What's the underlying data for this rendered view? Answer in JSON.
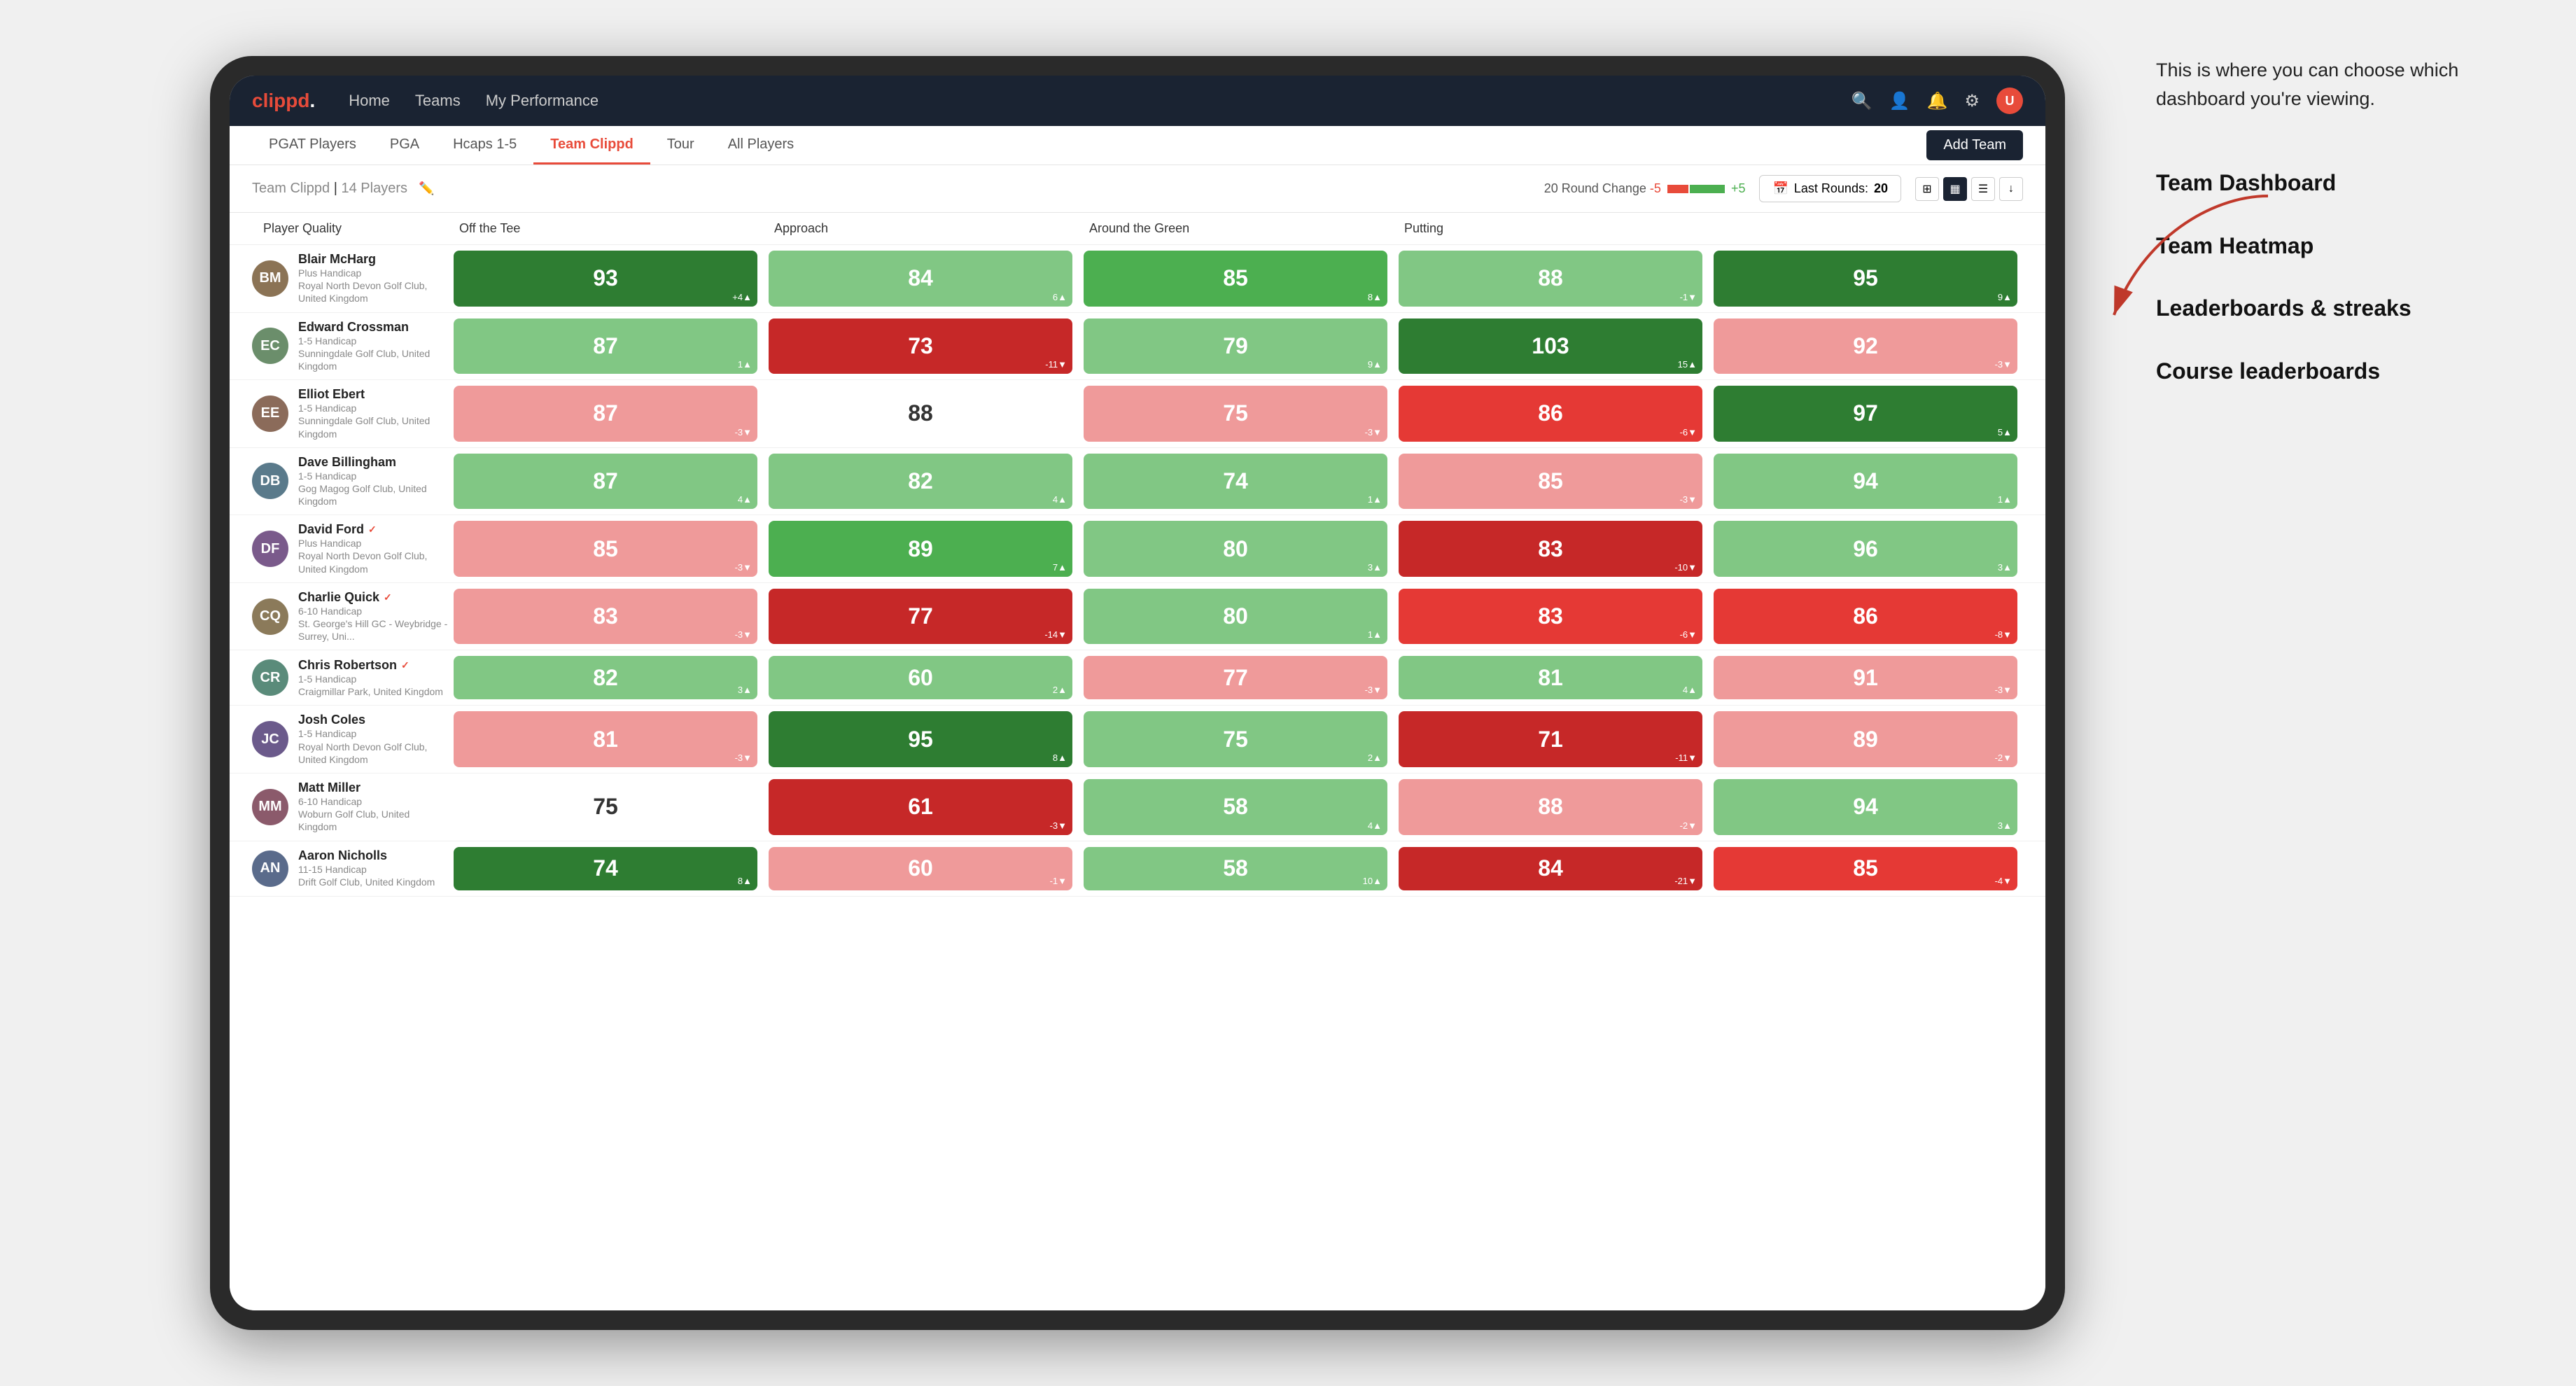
{
  "annotation": {
    "intro": "This is where you can choose which dashboard you're viewing.",
    "menu_items": [
      "Team Dashboard",
      "Team Heatmap",
      "Leaderboards & streaks",
      "Course leaderboards"
    ]
  },
  "nav": {
    "logo": "clippd",
    "links": [
      "Home",
      "Teams",
      "My Performance"
    ],
    "icons": [
      "search",
      "person",
      "bell",
      "settings",
      "avatar"
    ]
  },
  "sub_tabs": [
    "PGAT Players",
    "PGA",
    "Hcaps 1-5",
    "Team Clippd",
    "Tour",
    "All Players"
  ],
  "active_tab": "Team Clippd",
  "add_team_label": "Add Team",
  "team_header": {
    "title": "Team Clippd",
    "count": "14 Players",
    "round_change_label": "20 Round Change",
    "change_min": "-5",
    "change_max": "+5",
    "last_rounds_label": "Last Rounds:",
    "last_rounds_value": "20"
  },
  "columns": [
    {
      "label": "Player Quality",
      "sort": true
    },
    {
      "label": "Off the Tee",
      "sort": true
    },
    {
      "label": "Approach",
      "sort": true
    },
    {
      "label": "Around the Green",
      "sort": true
    },
    {
      "label": "Putting",
      "sort": true
    }
  ],
  "players": [
    {
      "name": "Blair McHarg",
      "handicap": "Plus Handicap",
      "club": "Royal North Devon Golf Club, United Kingdom",
      "verified": false,
      "avatar_color": "#8B7355",
      "initials": "BM",
      "scores": [
        {
          "value": 93,
          "change": "+4",
          "dir": "up",
          "color": "green-dark"
        },
        {
          "value": 84,
          "change": "6",
          "dir": "up",
          "color": "green-light"
        },
        {
          "value": 85,
          "change": "8",
          "dir": "up",
          "color": "green-med"
        },
        {
          "value": 88,
          "change": "-1",
          "dir": "down",
          "color": "green-light"
        },
        {
          "value": 95,
          "change": "9",
          "dir": "up",
          "color": "green-dark"
        }
      ]
    },
    {
      "name": "Edward Crossman",
      "handicap": "1-5 Handicap",
      "club": "Sunningdale Golf Club, United Kingdom",
      "verified": false,
      "avatar_color": "#6B8E6B",
      "initials": "EC",
      "scores": [
        {
          "value": 87,
          "change": "1",
          "dir": "up",
          "color": "green-light"
        },
        {
          "value": 73,
          "change": "-11",
          "dir": "down",
          "color": "red-dark"
        },
        {
          "value": 79,
          "change": "9",
          "dir": "up",
          "color": "green-light"
        },
        {
          "value": 103,
          "change": "15",
          "dir": "up",
          "color": "green-dark"
        },
        {
          "value": 92,
          "change": "-3",
          "dir": "down",
          "color": "red-light"
        }
      ]
    },
    {
      "name": "Elliot Ebert",
      "handicap": "1-5 Handicap",
      "club": "Sunningdale Golf Club, United Kingdom",
      "verified": false,
      "avatar_color": "#8B6B5A",
      "initials": "EE",
      "scores": [
        {
          "value": 87,
          "change": "-3",
          "dir": "down",
          "color": "red-light"
        },
        {
          "value": 88,
          "change": "",
          "dir": "",
          "color": "white-cell"
        },
        {
          "value": 75,
          "change": "-3",
          "dir": "down",
          "color": "red-light"
        },
        {
          "value": 86,
          "change": "-6",
          "dir": "down",
          "color": "red-med"
        },
        {
          "value": 97,
          "change": "5",
          "dir": "up",
          "color": "green-dark"
        }
      ]
    },
    {
      "name": "Dave Billingham",
      "handicap": "1-5 Handicap",
      "club": "Gog Magog Golf Club, United Kingdom",
      "verified": false,
      "avatar_color": "#5A7A8B",
      "initials": "DB",
      "scores": [
        {
          "value": 87,
          "change": "4",
          "dir": "up",
          "color": "green-light"
        },
        {
          "value": 82,
          "change": "4",
          "dir": "up",
          "color": "green-light"
        },
        {
          "value": 74,
          "change": "1",
          "dir": "up",
          "color": "green-light"
        },
        {
          "value": 85,
          "change": "-3",
          "dir": "down",
          "color": "red-light"
        },
        {
          "value": 94,
          "change": "1",
          "dir": "up",
          "color": "green-light"
        }
      ]
    },
    {
      "name": "David Ford",
      "handicap": "Plus Handicap",
      "club": "Royal North Devon Golf Club, United Kingdom",
      "verified": true,
      "avatar_color": "#7A5A8B",
      "initials": "DF",
      "scores": [
        {
          "value": 85,
          "change": "-3",
          "dir": "down",
          "color": "red-light"
        },
        {
          "value": 89,
          "change": "7",
          "dir": "up",
          "color": "green-med"
        },
        {
          "value": 80,
          "change": "3",
          "dir": "up",
          "color": "green-light"
        },
        {
          "value": 83,
          "change": "-10",
          "dir": "down",
          "color": "red-dark"
        },
        {
          "value": 96,
          "change": "3",
          "dir": "up",
          "color": "green-light"
        }
      ]
    },
    {
      "name": "Charlie Quick",
      "handicap": "6-10 Handicap",
      "club": "St. George's Hill GC - Weybridge - Surrey, Uni...",
      "verified": true,
      "avatar_color": "#8B7A5A",
      "initials": "CQ",
      "scores": [
        {
          "value": 83,
          "change": "-3",
          "dir": "down",
          "color": "red-light"
        },
        {
          "value": 77,
          "change": "-14",
          "dir": "down",
          "color": "red-dark"
        },
        {
          "value": 80,
          "change": "1",
          "dir": "up",
          "color": "green-light"
        },
        {
          "value": 83,
          "change": "-6",
          "dir": "down",
          "color": "red-med"
        },
        {
          "value": 86,
          "change": "-8",
          "dir": "down",
          "color": "red-med"
        }
      ]
    },
    {
      "name": "Chris Robertson",
      "handicap": "1-5 Handicap",
      "club": "Craigmillar Park, United Kingdom",
      "verified": true,
      "avatar_color": "#5A8B7A",
      "initials": "CR",
      "scores": [
        {
          "value": 82,
          "change": "3",
          "dir": "up",
          "color": "green-light"
        },
        {
          "value": 60,
          "change": "2",
          "dir": "up",
          "color": "green-light"
        },
        {
          "value": 77,
          "change": "-3",
          "dir": "down",
          "color": "red-light"
        },
        {
          "value": 81,
          "change": "4",
          "dir": "up",
          "color": "green-light"
        },
        {
          "value": 91,
          "change": "-3",
          "dir": "down",
          "color": "red-light"
        }
      ]
    },
    {
      "name": "Josh Coles",
      "handicap": "1-5 Handicap",
      "club": "Royal North Devon Golf Club, United Kingdom",
      "verified": false,
      "avatar_color": "#6B5A8B",
      "initials": "JC",
      "scores": [
        {
          "value": 81,
          "change": "-3",
          "dir": "down",
          "color": "red-light"
        },
        {
          "value": 95,
          "change": "8",
          "dir": "up",
          "color": "green-dark"
        },
        {
          "value": 75,
          "change": "2",
          "dir": "up",
          "color": "green-light"
        },
        {
          "value": 71,
          "change": "-11",
          "dir": "down",
          "color": "red-dark"
        },
        {
          "value": 89,
          "change": "-2",
          "dir": "down",
          "color": "red-light"
        }
      ]
    },
    {
      "name": "Matt Miller",
      "handicap": "6-10 Handicap",
      "club": "Woburn Golf Club, United Kingdom",
      "verified": false,
      "avatar_color": "#8B5A6B",
      "initials": "MM",
      "scores": [
        {
          "value": 75,
          "change": "",
          "dir": "",
          "color": "white-cell"
        },
        {
          "value": 61,
          "change": "-3",
          "dir": "down",
          "color": "red-dark"
        },
        {
          "value": 58,
          "change": "4",
          "dir": "up",
          "color": "green-light"
        },
        {
          "value": 88,
          "change": "-2",
          "dir": "down",
          "color": "red-light"
        },
        {
          "value": 94,
          "change": "3",
          "dir": "up",
          "color": "green-light"
        }
      ]
    },
    {
      "name": "Aaron Nicholls",
      "handicap": "11-15 Handicap",
      "club": "Drift Golf Club, United Kingdom",
      "verified": false,
      "avatar_color": "#5A6B8B",
      "initials": "AN",
      "scores": [
        {
          "value": 74,
          "change": "8",
          "dir": "up",
          "color": "green-dark"
        },
        {
          "value": 60,
          "change": "-1",
          "dir": "down",
          "color": "red-light"
        },
        {
          "value": 58,
          "change": "10",
          "dir": "up",
          "color": "green-light"
        },
        {
          "value": 84,
          "change": "-21",
          "dir": "down",
          "color": "red-dark"
        },
        {
          "value": 85,
          "change": "-4",
          "dir": "down",
          "color": "red-med"
        }
      ]
    }
  ],
  "colors": {
    "green_dark": "#2e7d32",
    "green_med": "#4caf50",
    "green_light": "#a5d6a7",
    "red_dark": "#c62828",
    "red_med": "#e53935",
    "red_light": "#ef9a9a",
    "white_cell": "#ffffff",
    "nav_bg": "#1a2332",
    "accent": "#e84b3a"
  }
}
